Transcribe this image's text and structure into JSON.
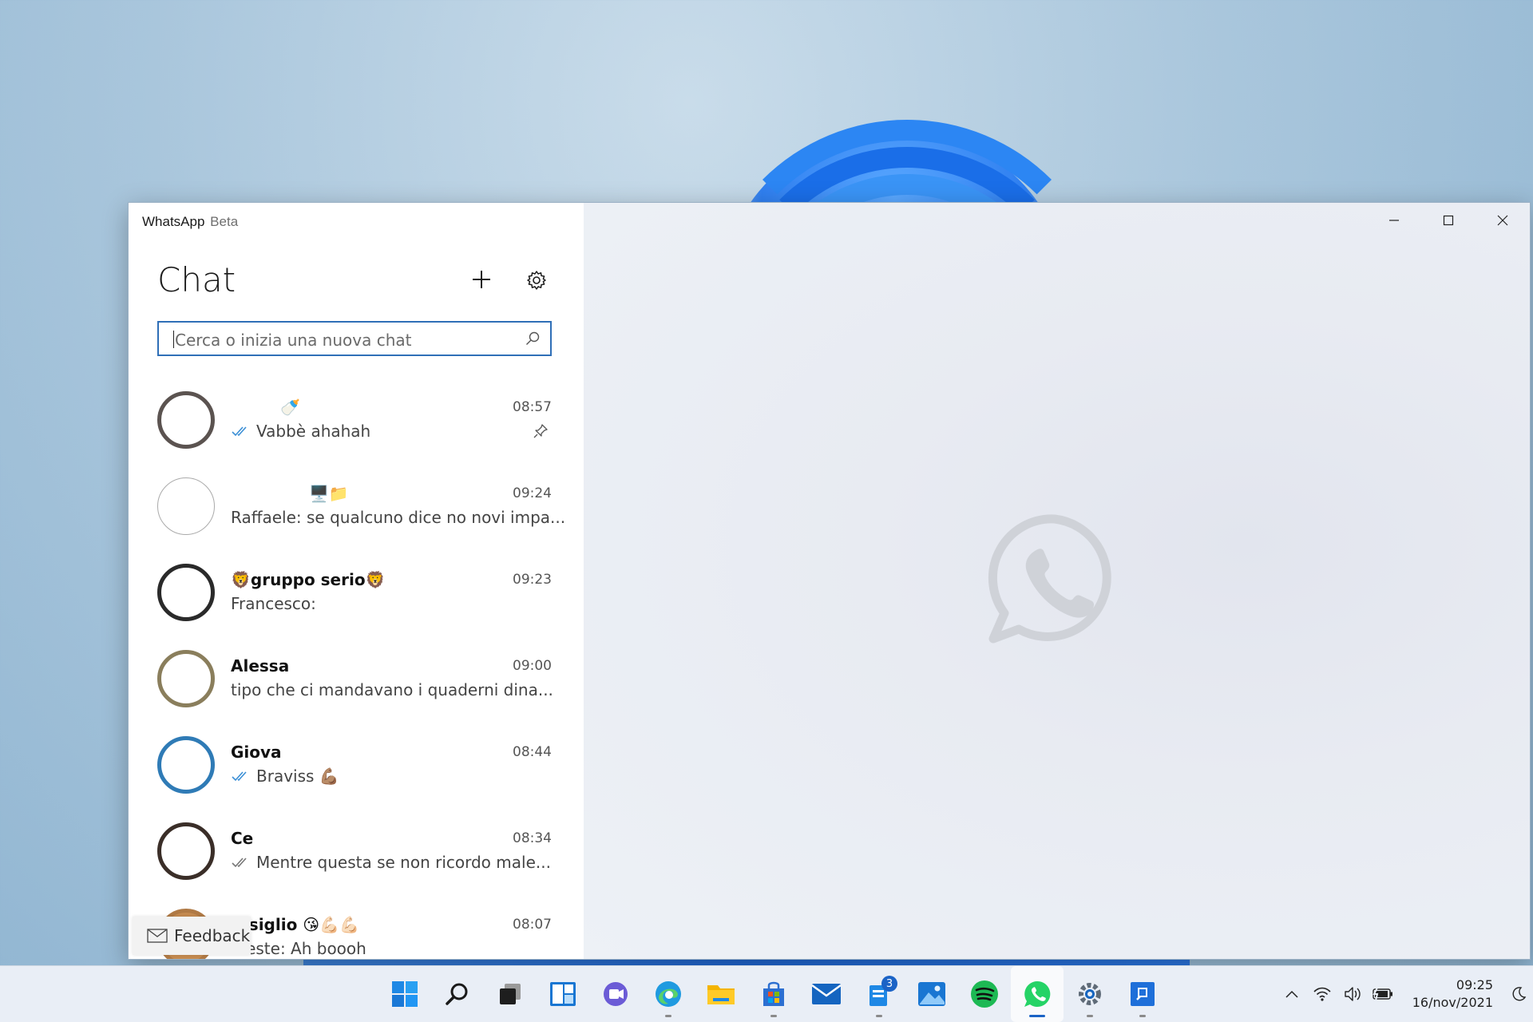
{
  "window": {
    "app_name": "WhatsApp",
    "app_suffix": "Beta"
  },
  "sidebar": {
    "title": "Chat",
    "search_placeholder": "Cerca o inizia una nuova chat"
  },
  "chats": [
    {
      "name": "",
      "name_emoji": "🍼",
      "time": "08:57",
      "preview": "Vabbè ahahah",
      "ticks": true,
      "pinned": true
    },
    {
      "name": "",
      "name_emoji": "🖥️📁",
      "time": "09:24",
      "preview": "Raffaele: se qualcuno dice no novi impa...",
      "ticks": false,
      "pinned": false
    },
    {
      "name": "🦁gruppo serio🦁",
      "name_emoji": "",
      "time": "09:23",
      "preview": "Francesco:",
      "ticks": false,
      "pinned": false
    },
    {
      "name": "Alessa",
      "name_emoji": "",
      "time": "09:00",
      "preview": "tipo che ci mandavano i quaderni dina...",
      "ticks": false,
      "pinned": false
    },
    {
      "name": "Giova",
      "name_emoji": "",
      "time": "08:44",
      "preview": "Braviss 💪🏽",
      "ticks": true,
      "pinned": false
    },
    {
      "name": "Ce",
      "name_emoji": "",
      "time": "08:34",
      "preview": "Mentre questa se non ricordo male...",
      "ticks": true,
      "pinned": false
    },
    {
      "name": "...siglio 😘💪🏻💪🏻",
      "name_emoji": "",
      "time": "08:07",
      "preview": "...este: Ah boooh",
      "ticks": false,
      "pinned": false
    }
  ],
  "feedback": {
    "label": "Feedback"
  },
  "taskbar": {
    "badge_count": "3",
    "clock_time": "09:25",
    "clock_date": "16/nov/2021"
  },
  "colors": {
    "accent": "#2f6fb7",
    "read_ticks": "#3b8fd6",
    "whatsapp_green": "#25d366"
  }
}
